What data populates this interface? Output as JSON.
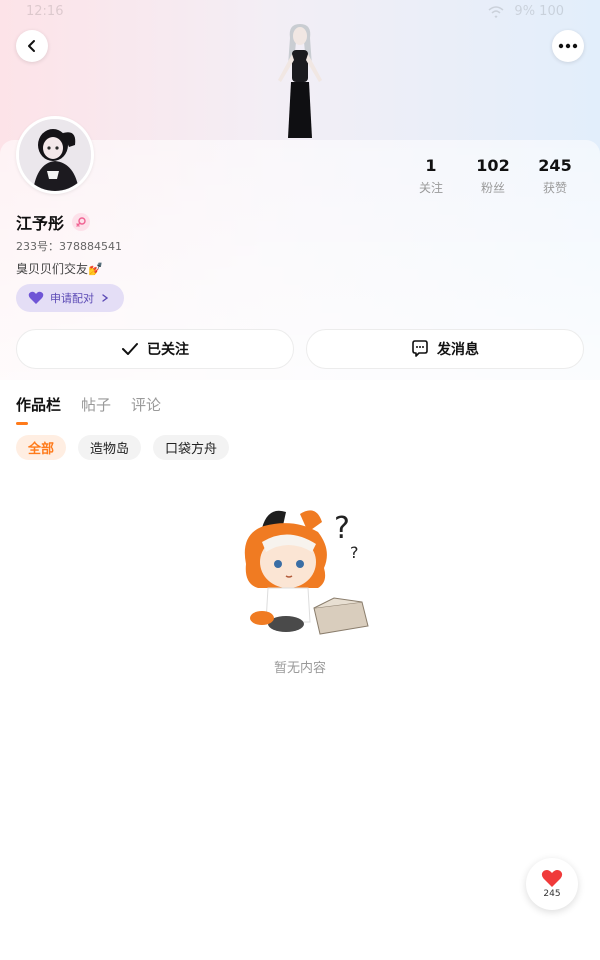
{
  "status_bar": {
    "time": "12:16",
    "right": "9% 100"
  },
  "profile": {
    "username": "江予彤",
    "uid": "233号：378884541",
    "bio": "臭贝贝们交友💅",
    "pair_button": "申请配对",
    "stats": [
      {
        "value": "1",
        "label": "关注"
      },
      {
        "value": "102",
        "label": "粉丝"
      },
      {
        "value": "245",
        "label": "获赞"
      }
    ]
  },
  "actions": {
    "follow_label": "已关注",
    "message_label": "发消息"
  },
  "tabs": [
    "作品栏",
    "帖子",
    "评论"
  ],
  "chips": [
    "全部",
    "造物岛",
    "口袋方舟"
  ],
  "empty_state": {
    "text": "暂无内容"
  },
  "like_fab": {
    "count": "245"
  },
  "colors": {
    "accent": "#ff7a1a",
    "pair_bg": "#e4def6",
    "pair_text": "#5b4ab5",
    "like_red": "#f03a3a"
  },
  "icons": [
    "back-icon",
    "more-icon",
    "heart-icon",
    "chevron-right-icon",
    "check-icon",
    "message-icon",
    "female-icon"
  ]
}
